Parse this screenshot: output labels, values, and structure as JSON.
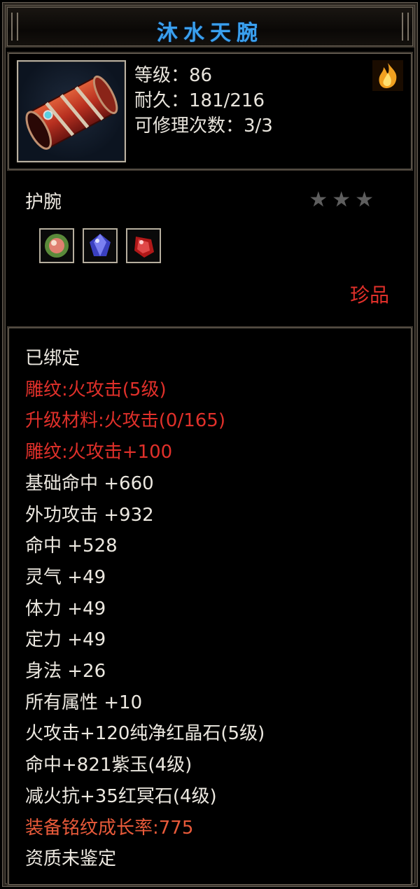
{
  "item": {
    "name": "沐水天腕",
    "level_line": "等级：86",
    "durability_line": "耐久：181/216",
    "repair_line": "可修理次数：3/3",
    "slot_type": "护腕",
    "stars": "★★★",
    "rarity": "珍品"
  },
  "icons": {
    "item": "bracer-icon",
    "flame": "flame-icon",
    "gems": [
      "gem-green-icon",
      "gem-blue-icon",
      "gem-red-icon"
    ]
  },
  "properties": [
    {
      "text": "已绑定",
      "color": "white"
    },
    {
      "text": "雕纹:火攻击(5级)",
      "color": "red"
    },
    {
      "text": "升级材料:火攻击(0/165)",
      "color": "red"
    },
    {
      "text": "雕纹:火攻击+100",
      "color": "red"
    },
    {
      "text": "基础命中  +660",
      "color": "white"
    },
    {
      "text": "外功攻击  +932",
      "color": "white"
    },
    {
      "text": "命中  +528",
      "color": "white"
    },
    {
      "text": "灵气  +49",
      "color": "white"
    },
    {
      "text": "体力  +49",
      "color": "white"
    },
    {
      "text": "定力  +49",
      "color": "white"
    },
    {
      "text": "身法  +26",
      "color": "white"
    },
    {
      "text": "所有属性  +10",
      "color": "white"
    },
    {
      "text": "火攻击+120纯净红晶石(5级)",
      "color": "white"
    },
    {
      "text": "命中+821紫玉(4级)",
      "color": "white"
    },
    {
      "text": "减火抗+35红冥石(4级)",
      "color": "white"
    },
    {
      "text": "装备铭纹成长率:775",
      "color": "orange"
    },
    {
      "text": "资质未鉴定",
      "color": "white"
    }
  ],
  "colors": {
    "title": "#3aa0ee",
    "red": "#e0302a",
    "orange": "#e85a3a",
    "white": "#ece8e0",
    "star": "#5e5e5e"
  }
}
